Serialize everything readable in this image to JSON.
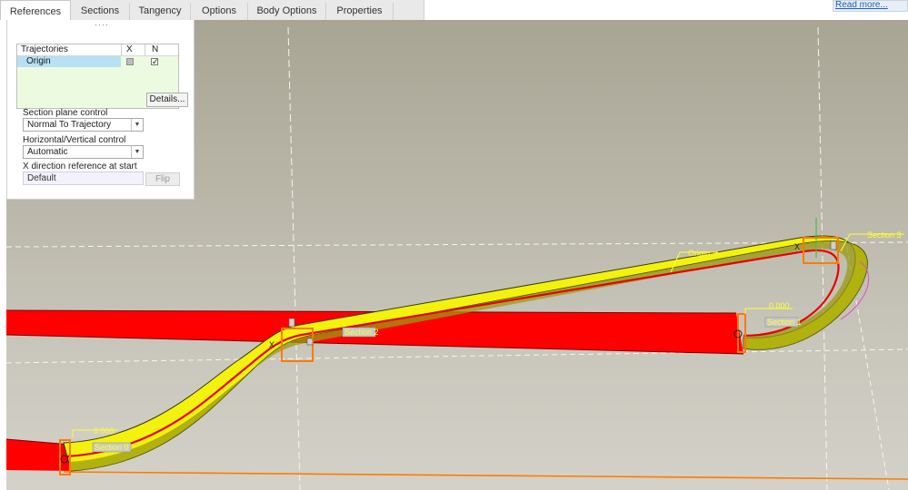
{
  "tabs": [
    {
      "label": "References",
      "active": true
    },
    {
      "label": "Sections",
      "active": false
    },
    {
      "label": "Tangency",
      "active": false
    },
    {
      "label": "Options",
      "active": false
    },
    {
      "label": "Body Options",
      "active": false
    },
    {
      "label": "Properties",
      "active": false
    }
  ],
  "read_more": "Read more...",
  "trajectories": {
    "header": {
      "name": "Trajectories",
      "x": "X",
      "n": "N"
    },
    "rows": [
      {
        "name": "Origin",
        "x_checked": false,
        "n_checked": true
      }
    ],
    "check_mark": "✓"
  },
  "details_label": "Details...",
  "section_plane_control": {
    "label": "Section plane control",
    "value": "Normal To Trajectory"
  },
  "horizontal_vertical_control": {
    "label": "Horizontal/Vertical control",
    "value": "Automatic"
  },
  "x_direction_reference": {
    "label": "X direction reference at start",
    "value": "Default"
  },
  "flip_label": "Flip",
  "dropdown_glyph": "▼",
  "viewport": {
    "trajectory_label": "Origin",
    "section_3_label": "Section 3",
    "section_2_label": "Section 2",
    "section_1_label": "Section 1",
    "section_start_label": "Section 0",
    "dim_1": "0.000",
    "dim_2": "0.000",
    "x_marker": "X"
  },
  "colors": {
    "sweep_yellow": "#f2f20e",
    "sweep_shade": "#9b9b12",
    "red_body": "#ff0000",
    "orange_edge": "#ff7a00",
    "label_yellow": "#ffff33"
  }
}
